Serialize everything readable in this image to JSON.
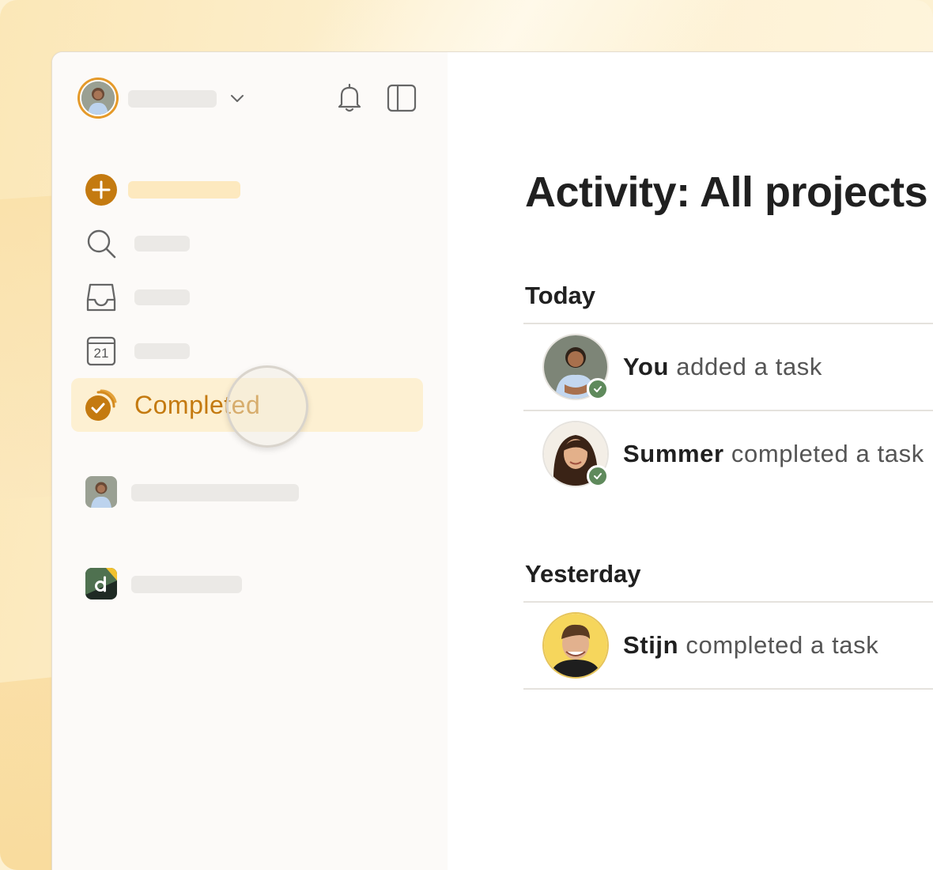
{
  "main": {
    "title": "Activity: All projects",
    "sections": [
      {
        "heading": "Today",
        "items": [
          {
            "actor": "You",
            "action": "added a task",
            "status": "completed"
          },
          {
            "actor": "Summer",
            "action": "completed a task",
            "status": "completed"
          }
        ]
      },
      {
        "heading": "Yesterday",
        "items": [
          {
            "actor": "Stijn",
            "action": "completed a task"
          }
        ]
      }
    ]
  },
  "sidebar": {
    "active_item": "Completed",
    "icons": {
      "add": "plus-circle-icon",
      "search": "search-icon",
      "inbox": "inbox-icon",
      "today": "calendar-icon",
      "completed": "completed-check-icon"
    },
    "calendar_day": "21"
  },
  "colors": {
    "accent": "#c47a10",
    "active_bg": "#fdf0d2",
    "check_badge": "#5f8a5c"
  }
}
